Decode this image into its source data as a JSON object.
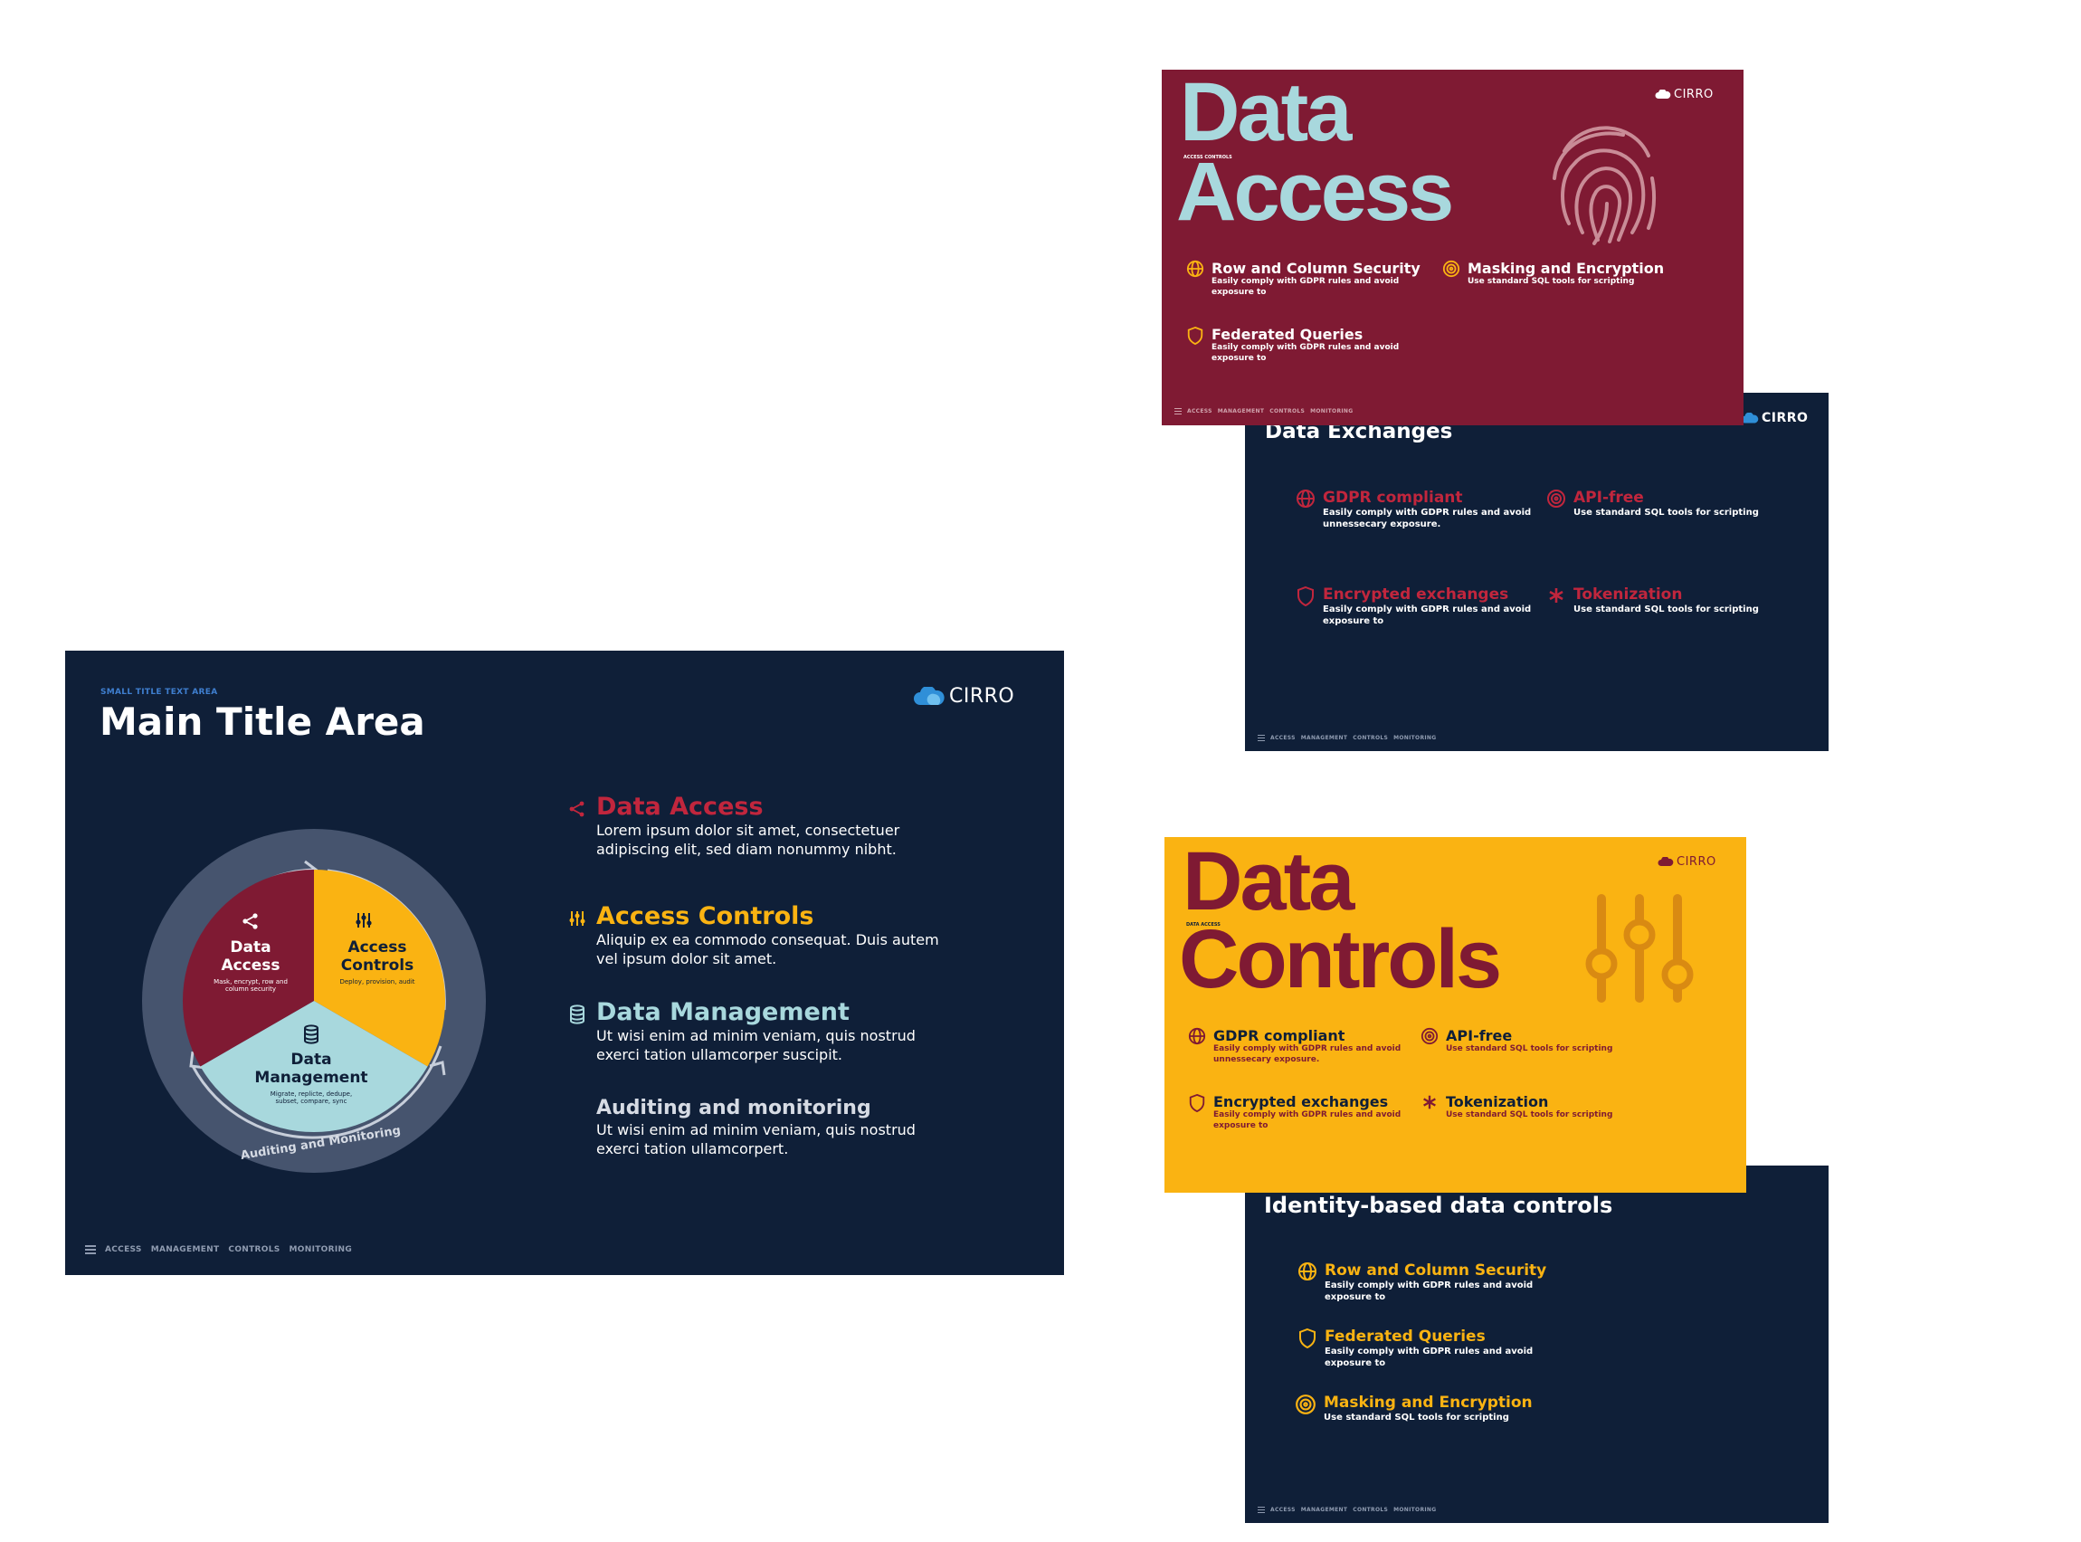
{
  "main_slide": {
    "small_title": "SMALL TITLE TEXT AREA",
    "title": "Main Title Area",
    "brand": "CIRRO",
    "wheel": {
      "data_access": {
        "title_1": "Data",
        "title_2": "Access",
        "desc_1": "Mask, encrypt, row and",
        "desc_2": "column security"
      },
      "access_controls": {
        "title_1": "Access",
        "title_2": "Controls",
        "desc_1": "Deploy, provision, audit"
      },
      "data_management": {
        "title_1": "Data",
        "title_2": "Management",
        "desc_1": "Migrate, replicte, dedupe,",
        "desc_2": "subset, compare, sync"
      },
      "ring_label": "Auditing and Monitoring"
    },
    "items": [
      {
        "title": "Data Access",
        "line_1": "Lorem ipsum dolor sit amet, consectetuer",
        "line_2": "adipiscing elit, sed diam nonummy nibht."
      },
      {
        "title": "Access Controls",
        "line_1": "Aliquip ex ea commodo consequat. Duis autem",
        "line_2": "vel ipsum dolor sit amet."
      },
      {
        "title": "Data Management",
        "line_1": "Ut wisi enim ad minim veniam, quis nostrud",
        "line_2": "exerci tation ullamcorper suscipit."
      },
      {
        "title": "Auditing and monitoring",
        "line_1": "Ut wisi enim ad minim veniam, quis nostrud",
        "line_2": "exerci tation ullamcorpert."
      }
    ],
    "footer": [
      "ACCESS",
      "MANAGEMENT",
      "CONTROLS",
      "MONITORING"
    ]
  },
  "data_access_slide": {
    "title_1": "Data",
    "title_2": "Access",
    "small_label": "ACCESS CONTROLS",
    "brand": "CIRRO",
    "features": [
      {
        "title": "Row and Column Security",
        "line_1": "Easily comply with GDPR rules and avoid",
        "line_2": "exposure to"
      },
      {
        "title": "Masking and Encryption",
        "line_1": "Use standard SQL tools for scripting",
        "line_2": ""
      },
      {
        "title": "Federated Queries",
        "line_1": "Easily comply with GDPR rules and avoid",
        "line_2": "exposure to"
      }
    ],
    "footer": [
      "ACCESS",
      "MANAGEMENT",
      "CONTROLS",
      "MONITORING"
    ]
  },
  "exchanges_slide": {
    "title": "Data Exchanges",
    "brand": "CIRRO",
    "features": [
      {
        "title": "GDPR compliant",
        "line_1": "Easily comply with GDPR rules and avoid",
        "line_2": "unnessecary exposure."
      },
      {
        "title": "API-free",
        "line_1": "Use standard SQL tools for scripting",
        "line_2": ""
      },
      {
        "title": "Encrypted exchanges",
        "line_1": "Easily comply with GDPR rules and avoid",
        "line_2": "exposure to"
      },
      {
        "title": "Tokenization",
        "line_1": "Use standard SQL tools for scripting",
        "line_2": ""
      }
    ],
    "footer": [
      "ACCESS",
      "MANAGEMENT",
      "CONTROLS",
      "MONITORING"
    ]
  },
  "data_controls_slide": {
    "title_1": "Data",
    "title_2": "Controls",
    "small_label": "DATA ACCESS",
    "brand": "CIRRO",
    "features": [
      {
        "title": "GDPR compliant",
        "line_1": "Easily comply with GDPR rules and avoid",
        "line_2": "unnessecary exposure."
      },
      {
        "title": "API-free",
        "line_1": "Use standard SQL tools for scripting",
        "line_2": ""
      },
      {
        "title": "Encrypted exchanges",
        "line_1": "Easily comply with GDPR rules and avoid",
        "line_2": "exposure to"
      },
      {
        "title": "Tokenization",
        "line_1": "Use standard SQL tools for scripting",
        "line_2": ""
      }
    ]
  },
  "identity_slide": {
    "title": "Identity-based data controls",
    "features": [
      {
        "title": "Row and Column Security",
        "line_1": "Easily comply with GDPR rules and avoid",
        "line_2": "exposure to"
      },
      {
        "title": "Federated Queries",
        "line_1": "Easily comply with GDPR rules and avoid",
        "line_2": "exposure to"
      },
      {
        "title": "Masking and Encryption",
        "line_1": "Use standard SQL tools for scripting",
        "line_2": ""
      }
    ],
    "footer": [
      "ACCESS",
      "MANAGEMENT",
      "CONTROLS",
      "MONITORING"
    ]
  },
  "colors": {
    "navy": "#0f1f38",
    "maroon": "#7f1a33",
    "gold": "#fab312",
    "light_blue": "#a8d8dd",
    "red_accent": "#c1263d",
    "ring": "#46546e"
  }
}
